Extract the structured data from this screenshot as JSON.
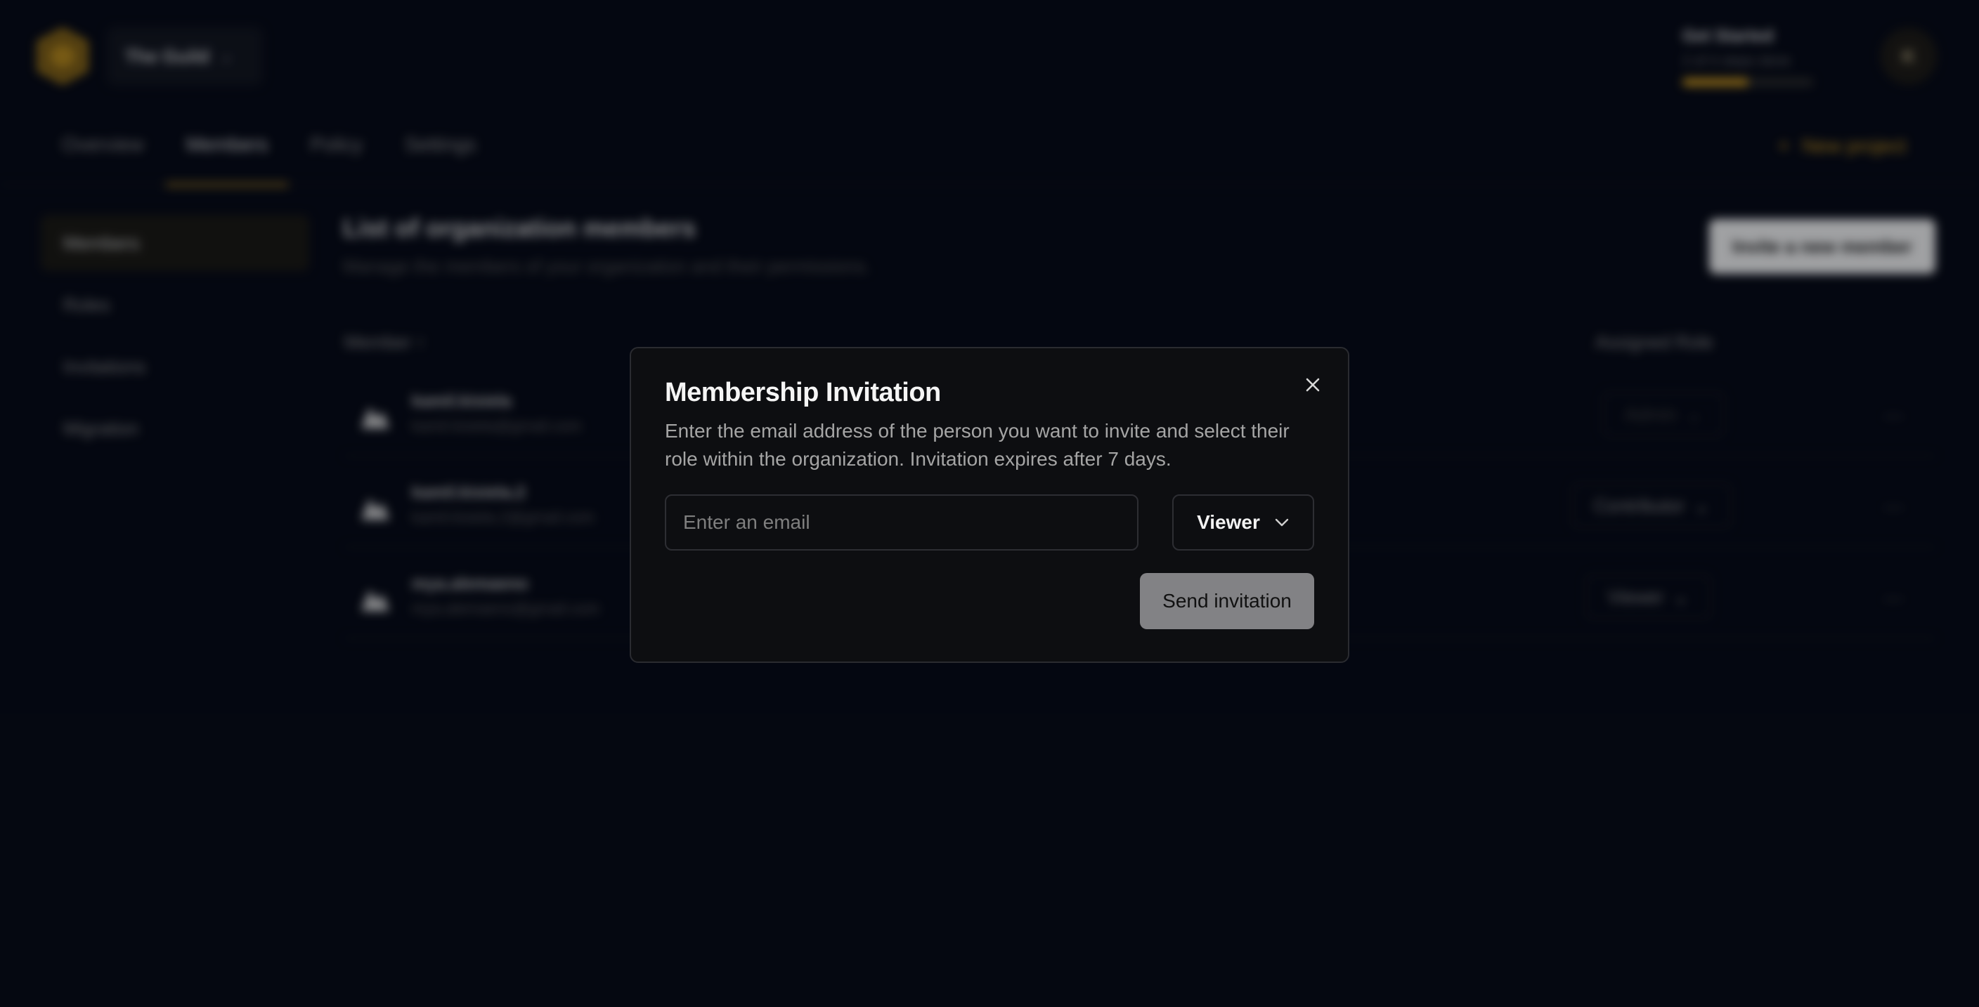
{
  "header": {
    "org_name": "The Guild",
    "get_started": {
      "title": "Get Started",
      "subtitle": "2 of 4 steps done",
      "progress": 0.5
    },
    "avatar_initial": "K",
    "new_project_label": "New project"
  },
  "tabs": [
    {
      "label": "Overview",
      "active": false
    },
    {
      "label": "Members",
      "active": true
    },
    {
      "label": "Policy",
      "active": false
    },
    {
      "label": "Settings",
      "active": false
    }
  ],
  "sidebar": {
    "items": [
      {
        "label": "Members",
        "active": true
      },
      {
        "label": "Roles",
        "active": false
      },
      {
        "label": "Invitations",
        "active": false
      },
      {
        "label": "Migration",
        "active": false
      }
    ]
  },
  "content": {
    "title": "List of organization members",
    "subtitle": "Manage the members of your organization and their permissions.",
    "invite_button": "Invite a new member",
    "columns": {
      "member": "Member",
      "member_sort_icon": "sort-arrow-icon",
      "role": "Assigned Role"
    },
    "members": [
      {
        "name": "kamil.kisiela",
        "email": "kamil.kisiela@gmail.com",
        "role": "Admin"
      },
      {
        "name": "kamil.kisiela.2",
        "email": "kamil.kisiela.2@gmail.com",
        "role": "Contributor"
      },
      {
        "name": "mya.alemaeno",
        "email": "mya.alemaeno@gmail.com",
        "role": "Viewer"
      }
    ],
    "row_more_icon": "more-horizontal-icon"
  },
  "modal": {
    "title": "Membership Invitation",
    "description": "Enter the email address of the person you want to invite and select their role within the organization. Invitation expires after 7 days.",
    "email_placeholder": "Enter an email",
    "email_value": "",
    "role_selected": "Viewer",
    "send_label": "Send invitation",
    "close_icon": "close-icon"
  },
  "colors": {
    "accent": "#c9961e",
    "background": "#060914",
    "modal_bg": "#0d0e11",
    "send_button_bg": "#828285"
  }
}
